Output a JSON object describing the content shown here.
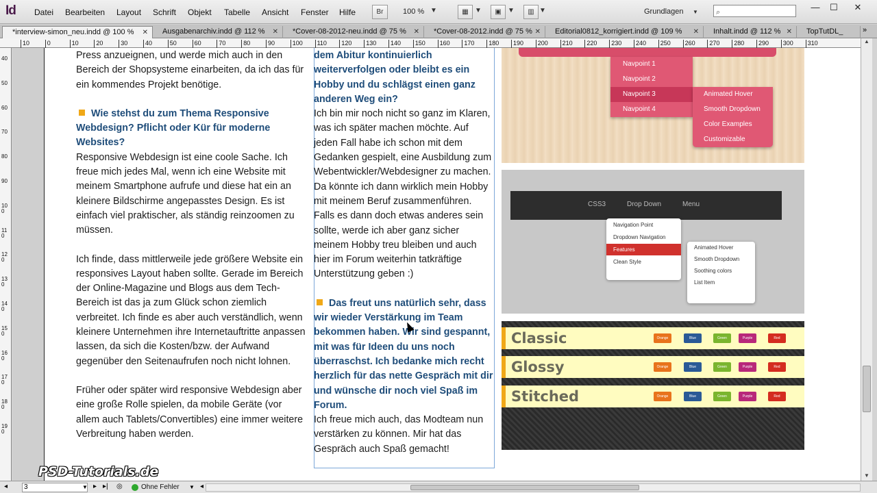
{
  "app": {
    "logo": "Id",
    "menu": [
      "Datei",
      "Bearbeiten",
      "Layout",
      "Schrift",
      "Objekt",
      "Tabelle",
      "Ansicht",
      "Fenster",
      "Hilfe"
    ],
    "bridge": "Br",
    "zoom": "100 %",
    "workspace": "Grundlagen",
    "win_min": "—",
    "win_max": "☐",
    "win_close": "✕"
  },
  "tabs": [
    "*interview-simon_neu.indd @ 100 %",
    "Ausgabenarchiv.indd @ 112 %",
    "*Cover-08-2012-neu.indd @ 75 %",
    "*Cover-08-2012.indd @ 75 %",
    "Editorial0812_korrigiert.indd @ 109 %",
    "Inhalt.indd @ 112 %",
    "TopTutDL_"
  ],
  "ruler": [
    "10",
    "0",
    "10",
    "20",
    "30",
    "40",
    "50",
    "60",
    "70",
    "80",
    "90",
    "100",
    "110",
    "120",
    "130",
    "140",
    "150",
    "160",
    "170",
    "180",
    "190",
    "200",
    "210",
    "220",
    "230",
    "240",
    "250",
    "260",
    "270",
    "280",
    "290",
    "300",
    "310"
  ],
  "vruler": [
    "40",
    "50",
    "60",
    "70",
    "80",
    "90",
    "100",
    "110",
    "120",
    "130",
    "140",
    "150",
    "160",
    "170",
    "180",
    "190"
  ],
  "col1": {
    "p1": "Press anzueignen, und werde mich auch in den Bereich der Shopsysteme einarbeiten, da ich das für ein kommendes Projekt benötige.",
    "q1": "Wie stehst du zum Thema Responsive Webdesign? Pflicht oder Kür für moderne Websites?",
    "p2": "Responsive Webdesign ist eine coole Sache. Ich freue mich jedes Mal, wenn ich eine Website mit meinem Smartphone aufrufe und diese hat ein an kleinere Bildschirme angepasstes Design. Es ist einfach viel praktischer, als ständig reinzoomen zu müssen.",
    "p3": "Ich finde, dass mittlerweile jede größere Website ein responsives Layout haben sollte. Gerade im Bereich der Online-Magazine und Blogs aus dem Tech-Bereich ist das ja zum Glück schon ziemlich verbreitet. Ich finde es aber auch verständlich, wenn kleinere Unternehmen ihre Internetauftritte anpassen lassen, da sich die Kosten/bzw. der Aufwand gegenüber den Seitenaufrufen noch nicht lohnen.",
    "p4": "Früher oder später wird responsive Webdesign aber eine große Rolle spielen, da mobile Geräte (vor allem auch Tablets/Convertibles) eine immer weitere Verbreitung haben werden."
  },
  "col2": {
    "q0": "dem Abitur kontinuierlich weiterverfolgen oder bleibt es ein Hobby und du schlägst einen ganz anderen Weg ein?",
    "p1": "Ich bin mir noch nicht so ganz im Klaren, was ich später machen möchte. Auf jeden Fall habe ich schon mit dem Gedanken gespielt, eine Ausbildung zum Webentwickler/Webdesigner zu machen. Da könnte ich dann wirklich mein Hobby mit meinem Beruf zusammenführen. Falls es dann doch etwas anderes sein sollte, werde ich aber ganz sicher meinem Hobby treu bleiben und auch hier im Forum weiterhin tatkräftige Unterstützung geben :)",
    "q1": "Das freut uns natürlich sehr, dass wir wieder Verstärkung im Team bekommen haben. Wir sind gespannt, mit was für Ideen du uns noch überraschst. Ich bedanke mich recht herzlich für das nette Gespräch mit dir und wünsche dir noch viel Spaß im Forum.",
    "p2": "Ich freue mich auch, das Modteam nun verstärken zu können. Mir hat das Gespräch auch Spaß gemacht!"
  },
  "img1": {
    "items": [
      "Navpoint 1",
      "Navpoint 2",
      "Navpoint 3",
      "Navpoint 4"
    ],
    "sub": [
      "Animated Hover",
      "Smooth Dropdown",
      "Color Examples",
      "Customizable"
    ]
  },
  "img2": {
    "nav": [
      "CSS3",
      "Drop Down",
      "Menu"
    ],
    "items": [
      "Navigation Point",
      "Dropdown Navigation",
      "Features",
      "Clean Style"
    ],
    "sub": [
      "Animated Hover",
      "Smooth Dropdown",
      "Soothing colors",
      "List Item"
    ]
  },
  "img3": {
    "bands": [
      "Classic",
      "Glossy",
      "Stitched"
    ],
    "chips": [
      "Orange",
      "Blue",
      "Green",
      "Purple",
      "Red"
    ],
    "chip_colors": [
      "#e8731c",
      "#2a5a96",
      "#7ab52e",
      "#b8287a",
      "#d42c20"
    ]
  },
  "status": {
    "page": "3",
    "errors": "Ohne Fehler"
  },
  "watermark": "PSD-Tutorials.de"
}
